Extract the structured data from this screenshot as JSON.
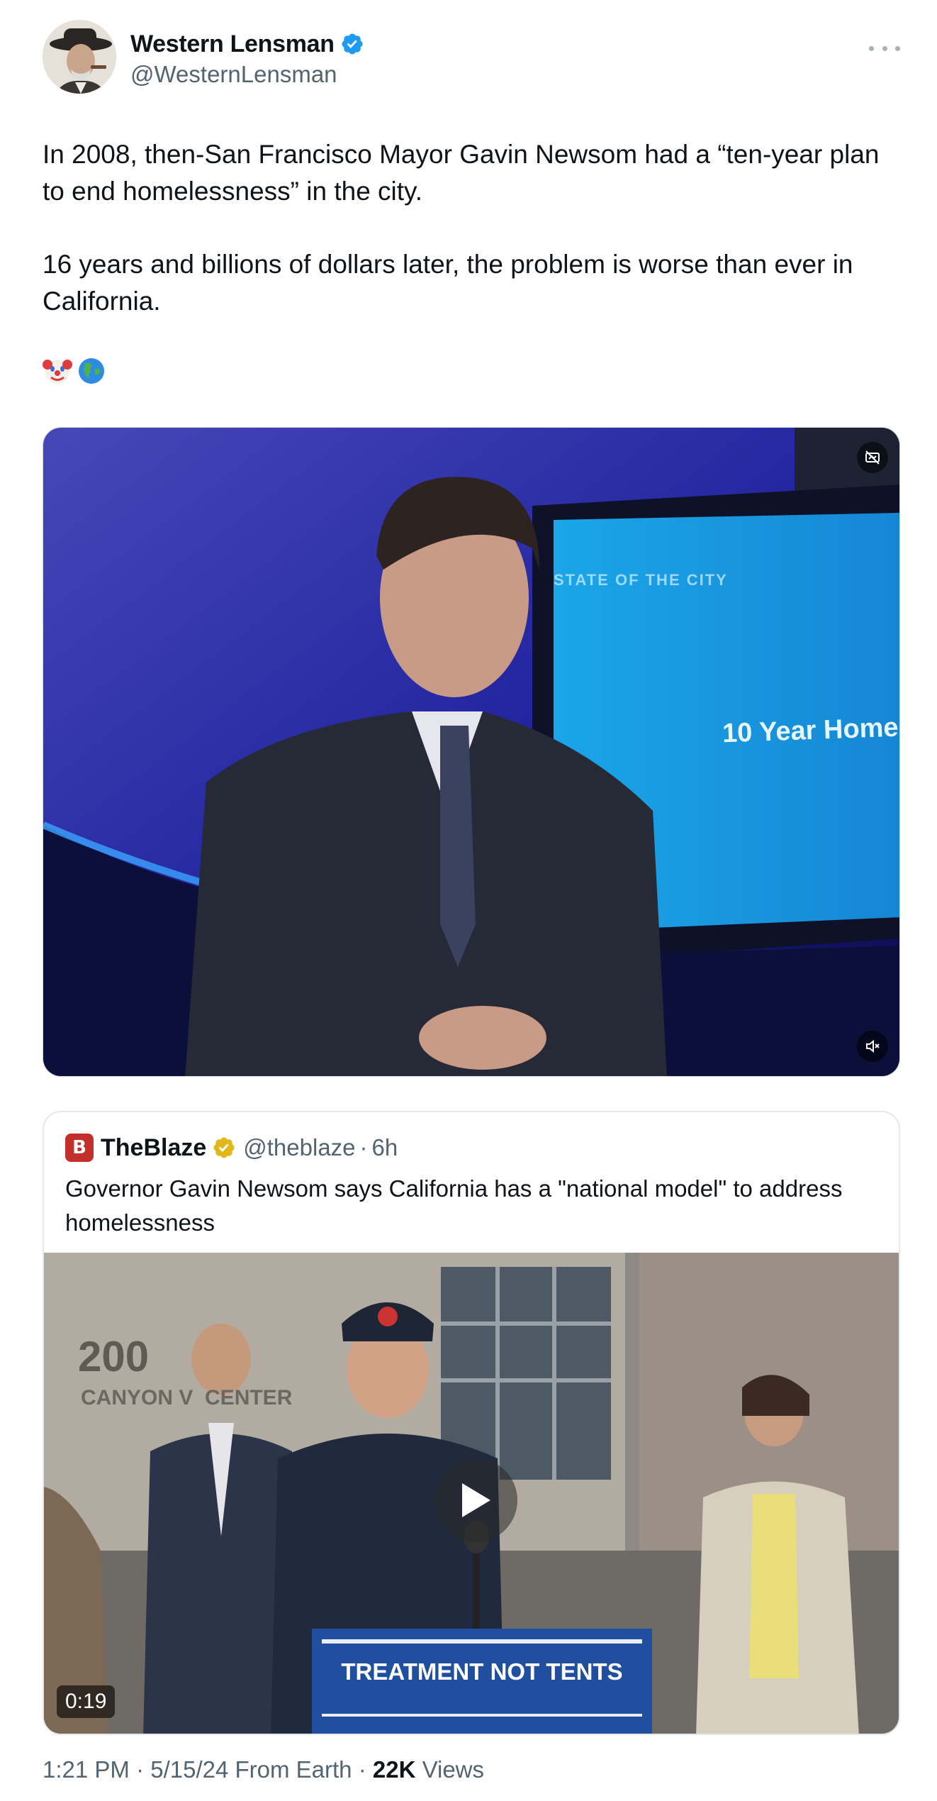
{
  "author": {
    "display_name": "Western Lensman",
    "handle": "@WesternLensman",
    "avatar_icon": "avatar-cowboy-portrait",
    "verified_badge_color": "#1d9bf0"
  },
  "tweet": {
    "paragraph_1": "In 2008, then-San Francisco Mayor Gavin Newsom had a “ten-year plan to end homelessness” in the city.",
    "paragraph_2": "16 years and billions of dollars later, the problem is worse than ever in California.",
    "emojis": [
      "🤡",
      "🌎"
    ]
  },
  "video": {
    "screen_text_top": "STATE OF THE CITY",
    "screen_text_main": "10 Year Home",
    "icons": [
      "content-warning-icon",
      "mute-icon"
    ]
  },
  "quote": {
    "logo_letter": "B",
    "display_name": "TheBlaze",
    "handle": "@theblaze",
    "separator": "·",
    "time": "6h",
    "text": "Governor Gavin Newsom says California has a \"national model\" to address homelessness",
    "gold_badge_color": "#e2b719",
    "media": {
      "building_number": "200",
      "building_sign": "CANYON V  CENTER",
      "podium_text": "TREATMENT NOT TENTS",
      "duration": "0:19"
    }
  },
  "meta": {
    "time_date_source": "1:21 PM · 5/15/24 From Earth · ",
    "views_count": "22K",
    "views_label": " Views"
  }
}
